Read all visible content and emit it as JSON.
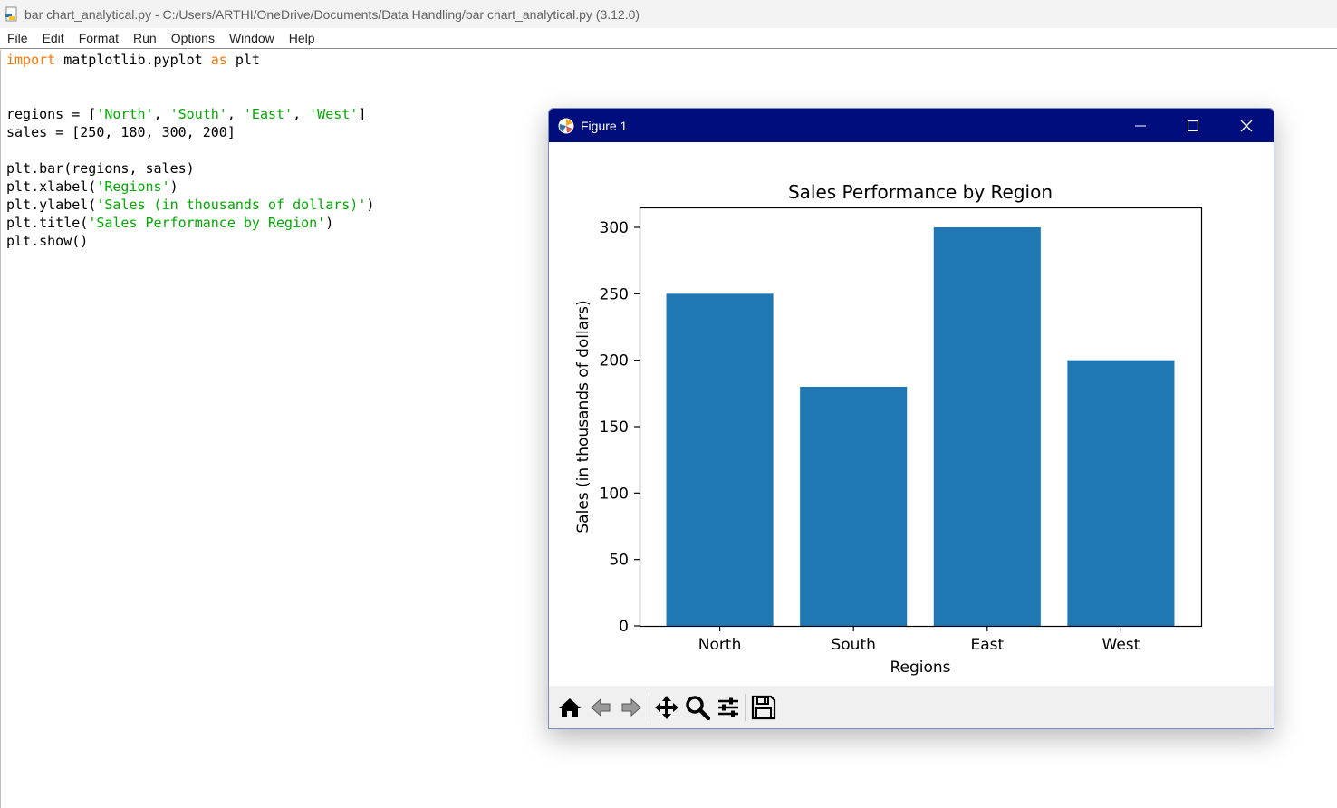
{
  "window": {
    "title": "bar chart_analytical.py - C:/Users/ARTHI/OneDrive/Documents/Data Handling/bar chart_analytical.py (3.12.0)"
  },
  "menu": [
    "File",
    "Edit",
    "Format",
    "Run",
    "Options",
    "Window",
    "Help"
  ],
  "code": {
    "l1_kw1": "import",
    "l1_mid": " matplotlib.pyplot ",
    "l1_kw2": "as",
    "l1_end": " plt",
    "l4_a": "regions = [",
    "l4_s1": "'North'",
    "l4_c1": ", ",
    "l4_s2": "'South'",
    "l4_c2": ", ",
    "l4_s3": "'East'",
    "l4_c3": ", ",
    "l4_s4": "'West'",
    "l4_e": "]",
    "l5": "sales = [250, 180, 300, 200]",
    "l7": "plt.bar(regions, sales)",
    "l8_a": "plt.xlabel(",
    "l8_s": "'Regions'",
    "l8_e": ")",
    "l9_a": "plt.ylabel(",
    "l9_s": "'Sales (in thousands of dollars)'",
    "l9_e": ")",
    "l10_a": "plt.title(",
    "l10_s": "'Sales Performance by Region'",
    "l10_e": ")",
    "l11": "plt.show()"
  },
  "figure": {
    "title": "Figure 1",
    "toolbar": {
      "icons": [
        "home-icon",
        "back-icon",
        "forward-icon",
        "pan-icon",
        "zoom-icon",
        "configure-icon",
        "save-icon"
      ]
    }
  },
  "colors": {
    "bar": "#1f77b4",
    "keyword": "#ff7700",
    "string": "#00aa00",
    "figure_titlebar": "#000e7d"
  },
  "chart_data": {
    "type": "bar",
    "title": "Sales Performance by Region",
    "xlabel": "Regions",
    "ylabel": "Sales (in thousands of dollars)",
    "categories": [
      "North",
      "South",
      "East",
      "West"
    ],
    "values": [
      250,
      180,
      300,
      200
    ],
    "yticks": [
      0,
      50,
      100,
      150,
      200,
      250,
      300
    ],
    "ylim": [
      0,
      315
    ],
    "grid": false,
    "legend": false
  }
}
